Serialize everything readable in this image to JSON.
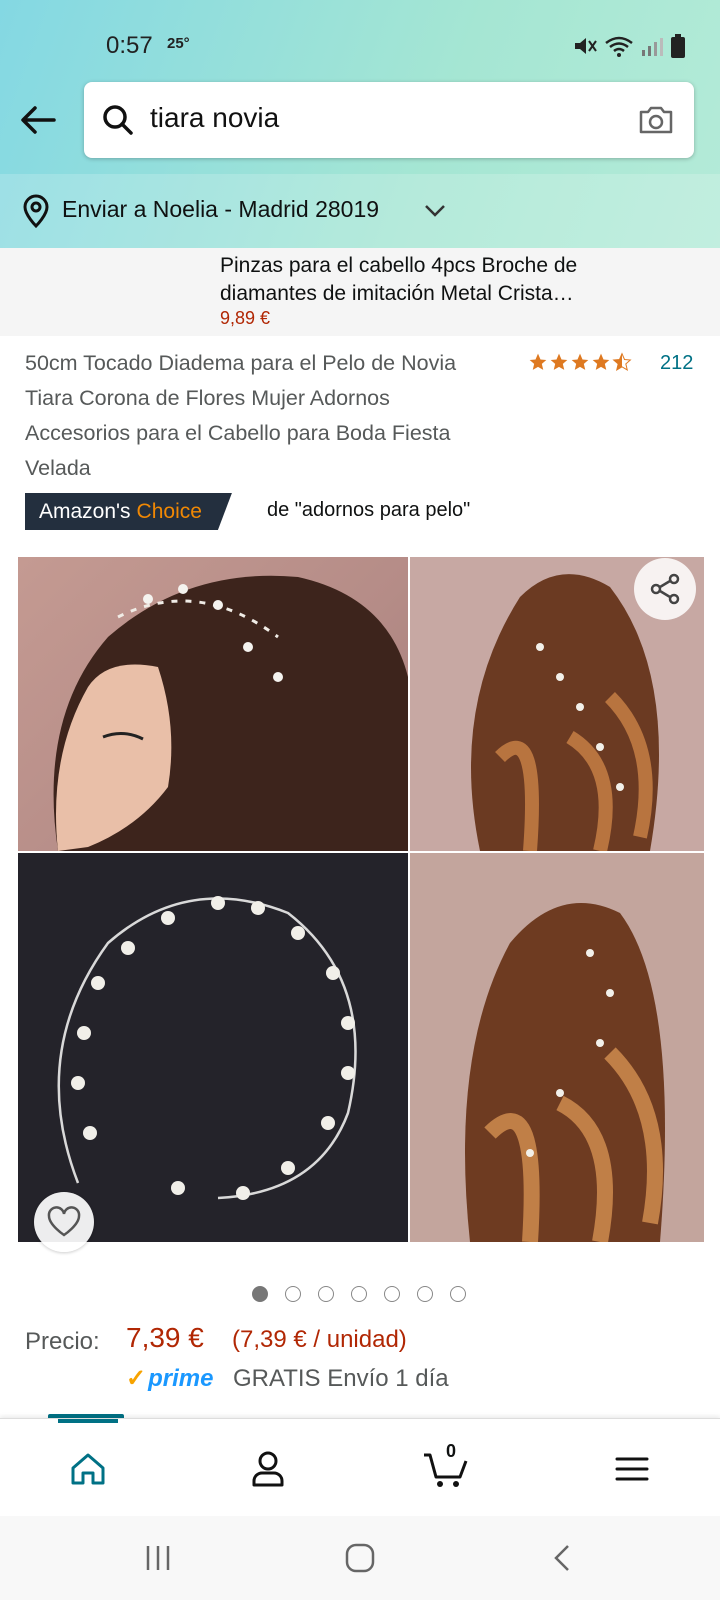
{
  "status_bar": {
    "time": "0:57",
    "temperature": "25°"
  },
  "search": {
    "query": "tiara novia"
  },
  "delivery": {
    "text": "Enviar a Noelia - Madrid 28019"
  },
  "sponsored": {
    "title": "Pinzas para el cabello 4pcs Broche de diamantes de imitación Metal Crista…",
    "price": "9,89 €"
  },
  "product": {
    "title": "50cm Tocado Diadema para el Pelo de Novia Tiara Corona de Flores Mujer Adornos Accesorios para el Cabello para Boda Fiesta Velada",
    "rating_stars": 4.5,
    "rating_count": "212",
    "choice_badge_prefix": "Amazon's",
    "choice_badge_accent": "Choice",
    "choice_description": "de \"adornos para pelo\"",
    "price_label": "Precio:",
    "price": "7,39 €",
    "unit_price": "(7,39 € / unidad)",
    "prime_label": "prime",
    "shipping": "GRATIS Envío 1 día",
    "image_count": 7,
    "active_image_index": 0
  },
  "icons": {
    "back": "back-arrow-icon",
    "search": "search-icon",
    "camera": "camera-icon",
    "location": "location-pin-icon",
    "share": "share-icon",
    "favorite": "heart-icon",
    "home": "home-icon",
    "account": "user-icon",
    "cart": "cart-icon",
    "menu": "menu-icon"
  },
  "bottom_nav": {
    "cart_count": "0",
    "active": "home"
  },
  "colors": {
    "accent_teal": "#007185",
    "price_red": "#b12704",
    "badge_navy": "#232f3e",
    "badge_orange": "#f08804",
    "prime_blue": "#1a98ff",
    "star_orange": "#de7921"
  }
}
